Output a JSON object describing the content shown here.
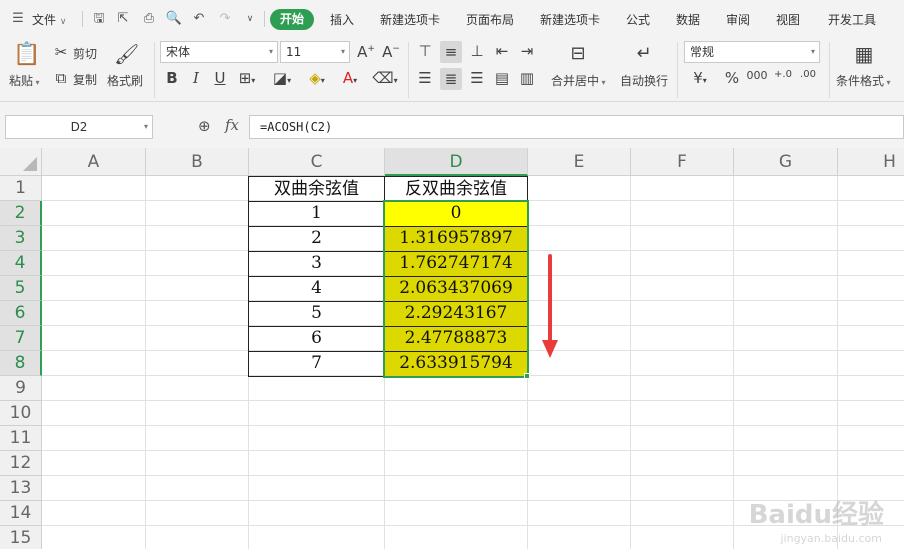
{
  "menubar": {
    "file_label": "文件",
    "tabs": [
      {
        "label": "开始",
        "active": true
      },
      {
        "label": "插入"
      },
      {
        "label": "新建选项卡"
      },
      {
        "label": "页面布局"
      },
      {
        "label": "新建选项卡"
      },
      {
        "label": "公式"
      },
      {
        "label": "数据"
      },
      {
        "label": "审阅"
      },
      {
        "label": "视图"
      },
      {
        "label": "开发工具"
      }
    ]
  },
  "ribbon": {
    "paste": "粘贴",
    "cut": "剪切",
    "copy": "复制",
    "format_painter": "格式刷",
    "font_name": "宋体",
    "font_size": "11",
    "merge_center": "合并居中",
    "wrap_text": "自动换行",
    "number_format": "常规",
    "conditional_format": "条件格式"
  },
  "formula_bar": {
    "name_box": "D2",
    "fx": "fx",
    "formula": "=ACOSH(C2)"
  },
  "sheet": {
    "columns": [
      "A",
      "B",
      "C",
      "D",
      "E",
      "F",
      "G",
      "H"
    ],
    "selected_column": "D",
    "rows": [
      "1",
      "2",
      "3",
      "4",
      "5",
      "6",
      "7",
      "8",
      "9",
      "10",
      "11",
      "12",
      "13",
      "14",
      "15"
    ],
    "selected_rows": [
      "2",
      "3",
      "4",
      "5",
      "6",
      "7",
      "8"
    ],
    "table": {
      "header_c": "双曲余弦值",
      "header_d": "反双曲余弦值",
      "c_values": [
        "1",
        "2",
        "3",
        "4",
        "5",
        "6",
        "7"
      ],
      "d_values": [
        "0",
        "1.316957897",
        "1.762747174",
        "2.063437069",
        "2.29243167",
        "2.47788873",
        "2.633915794"
      ]
    }
  },
  "colors": {
    "accent": "#2e9e52",
    "active_cell_fill": "#ffff00",
    "range_fill": "#dcd800",
    "arrow": "#e83b3b"
  },
  "watermark": {
    "logo": "Baidu经验",
    "url": "jingyan.baidu.com"
  }
}
